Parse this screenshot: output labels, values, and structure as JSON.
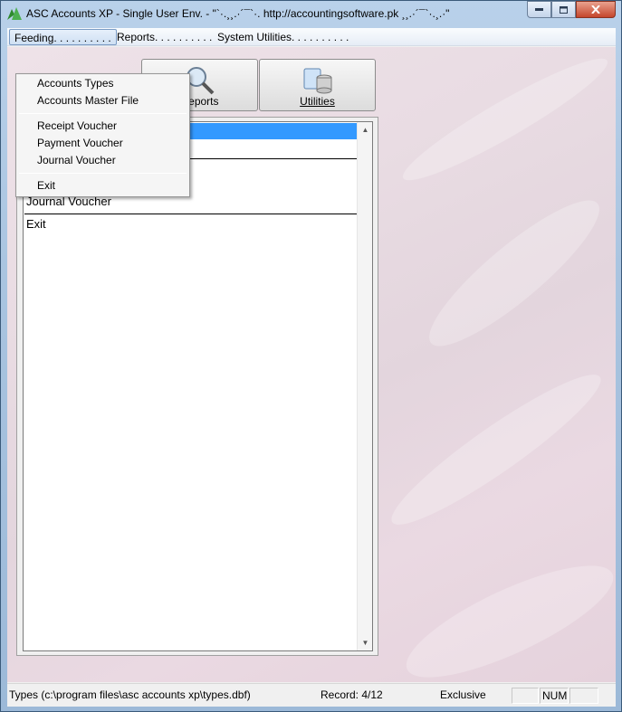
{
  "window": {
    "title": "ASC Accounts XP - Single User Env.  - \"`·.¸¸.·´¯`·. http://accountingsoftware.pk ¸¸.·´¯`·.¸.·\""
  },
  "menubar": {
    "items": [
      {
        "label": "Feeding. . . . . . . . . ."
      },
      {
        "label": "Reports. . . . . . . . . ."
      },
      {
        "label": "System Utilities. . . . . . . . . ."
      }
    ]
  },
  "toolbar": {
    "reports_label": "Reports",
    "utilities_label": "Utilities"
  },
  "list": {
    "rows": [
      {
        "label": ""
      },
      {
        "label": "Accounts Master File"
      },
      {
        "label": "Receipt Voucher"
      },
      {
        "label": "Payment Voucher"
      },
      {
        "label": "Journal Voucher"
      },
      {
        "label": "Exit"
      }
    ]
  },
  "dropdown": {
    "items": [
      {
        "label": "Accounts Types"
      },
      {
        "label": "Accounts Master File"
      },
      {
        "label": "Receipt Voucher"
      },
      {
        "label": "Payment Voucher"
      },
      {
        "label": "Journal Voucher"
      },
      {
        "label": "Exit"
      }
    ]
  },
  "statusbar": {
    "path": "Types (c:\\program files\\asc accounts xp\\types.dbf)",
    "record": "Record: 4/12",
    "mode": "Exclusive",
    "num": "NUM"
  },
  "colors": {
    "selection": "#3399ff",
    "background": "#e9dce3"
  },
  "icons": [
    "app-logo-icon",
    "minimize-icon",
    "maximize-icon",
    "close-icon",
    "magnifier-icon",
    "database-icon",
    "scroll-up-icon",
    "scroll-down-icon"
  ]
}
